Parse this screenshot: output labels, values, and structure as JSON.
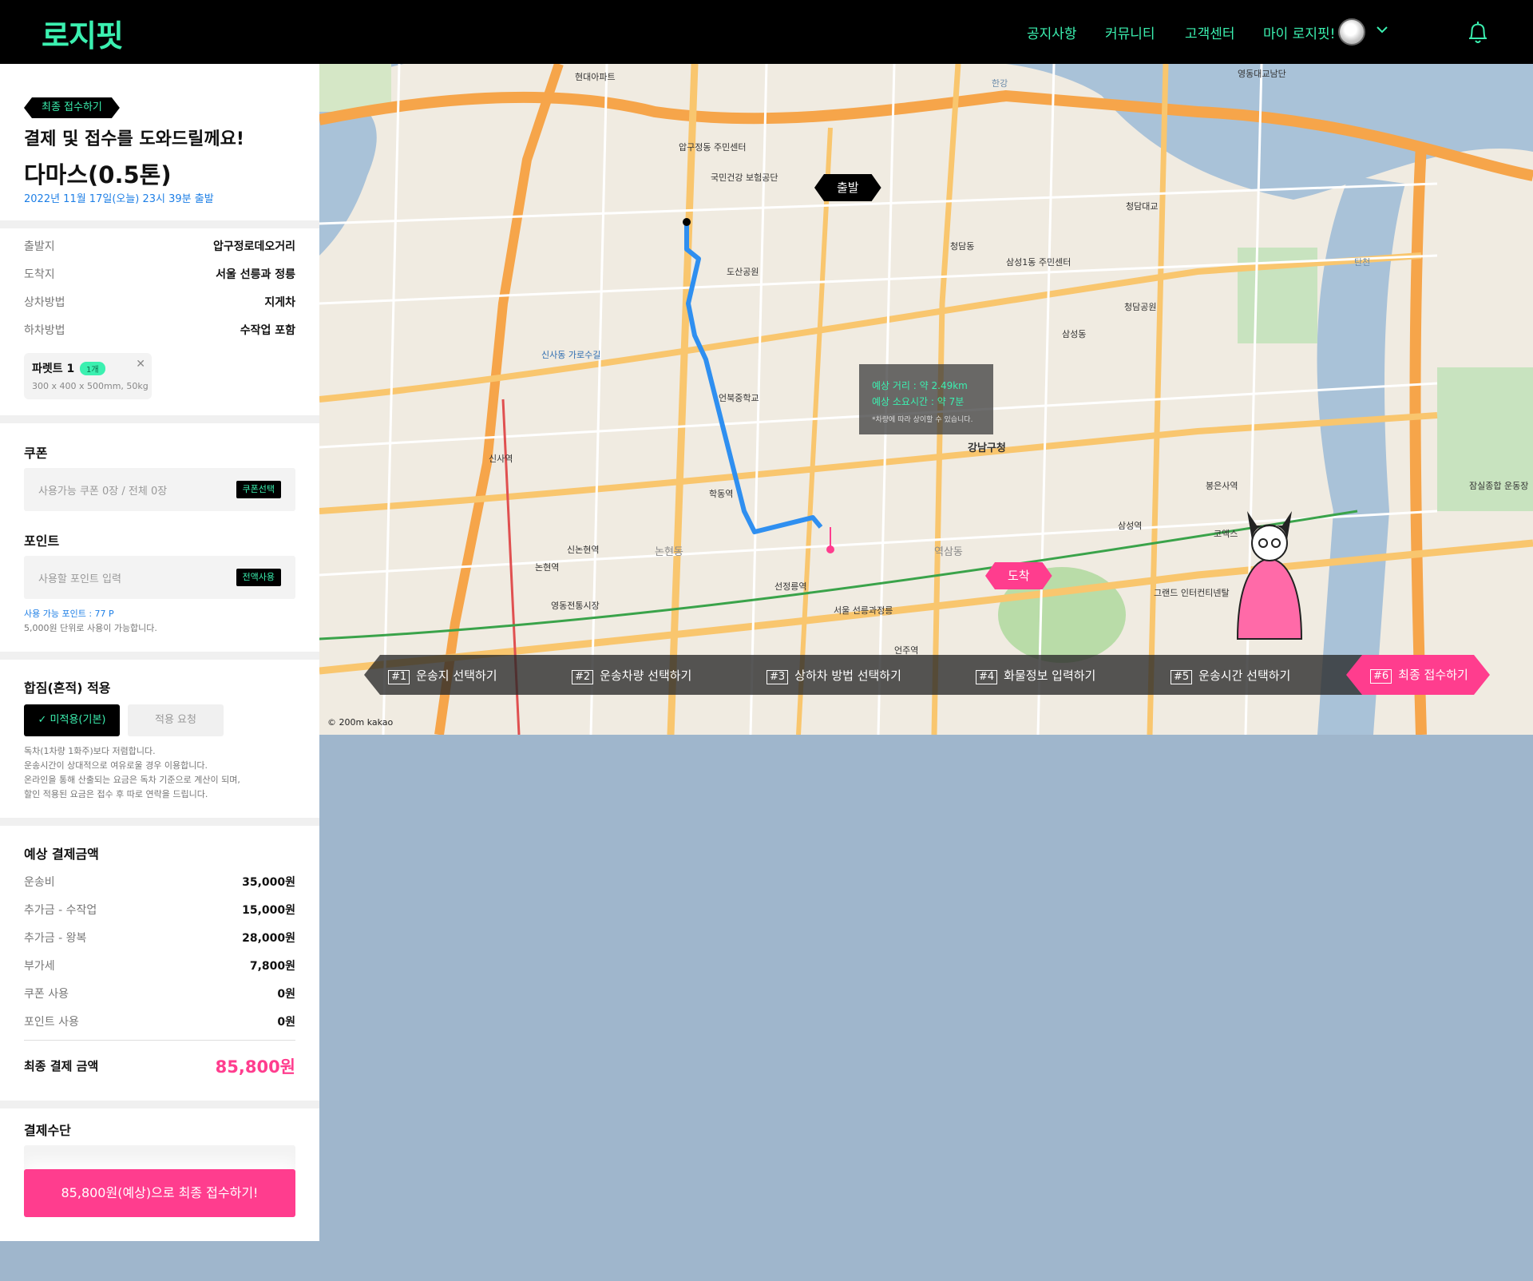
{
  "header": {
    "logo": "로지핏",
    "nav": [
      "공지사항",
      "커뮤니티",
      "고객센터",
      "마이 로지핏!"
    ]
  },
  "summary": {
    "badge": "최종 접수하기",
    "title": "결제 및 접수를 도와드릴께요!",
    "vehicle": "다마스(0.5톤)",
    "departure_time": "2022년 11월 17일(오늘) 23시 39분 출발"
  },
  "details": [
    {
      "label": "출발지",
      "value": "압구정로데오거리"
    },
    {
      "label": "도착지",
      "value": "서울 선릉과 정릉"
    },
    {
      "label": "상차방법",
      "value": "지게차"
    },
    {
      "label": "하차방법",
      "value": "수작업 포함"
    }
  ],
  "cargo": {
    "name": "파렛트 1",
    "count": "1개",
    "size": "300 x 400 x 500mm, 50kg"
  },
  "coupon": {
    "title": "쿠폰",
    "placeholder": "사용가능 쿠폰 0장 / 전체 0장",
    "button": "쿠폰선택"
  },
  "point": {
    "title": "포인트",
    "placeholder": "사용할 포인트 입력",
    "button": "전액사용",
    "available": "사용 가능 포인트 : 77 P",
    "unit_note": "5,000원 단위로 사용이 가능합니다."
  },
  "mixed": {
    "title": "합짐(혼적) 적용",
    "option_on": "미적용(기본)",
    "option_off": "적용 요청",
    "notes": [
      "독차(1차량 1화주)보다 저렴합니다.",
      "운송시간이 상대적으로 여유로울 경우 이용합니다.",
      "온라인을 통해 산출되는 요금은 독차 기준으로 계산이 되며,",
      "할인 적용된 요금은 접수 후 따로 연락을 드립니다."
    ]
  },
  "estimate": {
    "title": "예상 결제금액",
    "items": [
      {
        "label": "운송비",
        "value": "35,000원"
      },
      {
        "label": "추가금 - 수작업",
        "value": "15,000원"
      },
      {
        "label": "추가금 - 왕복",
        "value": "28,000원"
      },
      {
        "label": "부가세",
        "value": "7,800원"
      },
      {
        "label": "쿠폰 사용",
        "value": "0원"
      },
      {
        "label": "포인트 사용",
        "value": "0원"
      }
    ],
    "total_label": "최종 결제 금액",
    "total_value": "85,800원"
  },
  "payment": {
    "title": "결제수단"
  },
  "cta": "85,800원(예상)으로 최종 접수하기!",
  "map": {
    "start_pin": "출발",
    "end_pin": "도착",
    "info_distance": "예상 거리 : 약 2.49km",
    "info_time": "예상 소요시간 : 약 7분",
    "info_note": "*차량에 따라 상이할 수 있습니다.",
    "copyright": "© 200m kakao",
    "labels": [
      "현대아파트",
      "압구정동 주민센터",
      "신사역",
      "논현역",
      "강남구청",
      "선정릉역",
      "서울 선릉과정릉",
      "청담동",
      "삼성1동 주민센터",
      "신사동 가로수길",
      "국민건강 보험공단",
      "학동역",
      "언북중학교",
      "삼성동",
      "영동대교남단",
      "청담대교",
      "삼성역",
      "봉은사역",
      "잠실종합 운동장",
      "청담공원",
      "논현동",
      "역삼동",
      "한강",
      "탄천",
      "도산공원",
      "영동전통시장",
      "신논현역",
      "그랜드 인터컨티넨탈",
      "코엑스",
      "언주역"
    ]
  },
  "steps": [
    {
      "no": "#1",
      "label": "운송지 선택하기"
    },
    {
      "no": "#2",
      "label": "운송차량 선택하기"
    },
    {
      "no": "#3",
      "label": "상하차 방법 선택하기"
    },
    {
      "no": "#4",
      "label": "화물정보 입력하기"
    },
    {
      "no": "#5",
      "label": "운송시간 선택하기"
    },
    {
      "no": "#6",
      "label": "최종 접수하기"
    }
  ],
  "colors": {
    "brand": "#3bf0b0",
    "accent": "#ff3d8e",
    "route": "#2f8ff0",
    "link": "#1e7fe6"
  }
}
